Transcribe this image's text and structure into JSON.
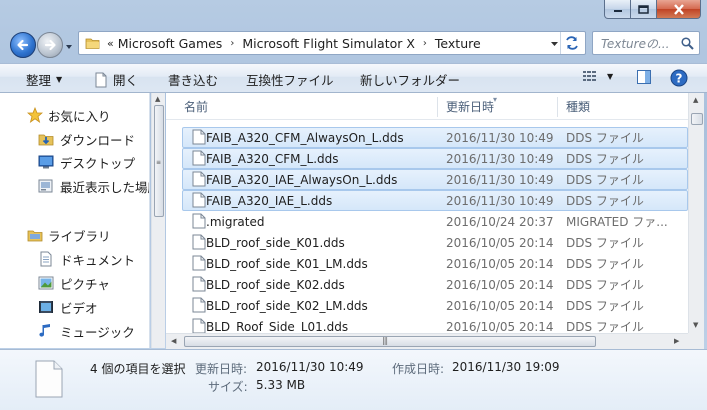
{
  "window": {
    "minimize_label": "Minimize",
    "maximize_label": "Maximize",
    "close_label": "Close"
  },
  "address": {
    "overflow": "«",
    "crumbs": [
      "Microsoft Games",
      "Microsoft Flight Simulator X",
      "Texture"
    ],
    "separator": "›"
  },
  "search": {
    "placeholder": "Textureの..."
  },
  "toolbar": {
    "organize": "整理",
    "open": "開く",
    "burn": "書き込む",
    "compat": "互換性ファイル",
    "new_folder": "新しいフォルダー"
  },
  "navpane": {
    "favorites": "お気に入り",
    "downloads": "ダウンロード",
    "desktop": "デスクトップ",
    "recent": "最近表示した場所",
    "libraries": "ライブラリ",
    "documents": "ドキュメント",
    "pictures": "ピクチャ",
    "videos": "ビデオ",
    "music": "ミュージック"
  },
  "columns": {
    "name": "名前",
    "date": "更新日時",
    "type": "種類"
  },
  "files": [
    {
      "name": "FAIB_A320_CFM_AlwaysOn_L.dds",
      "date": "2016/11/30 10:49",
      "type": "DDS ファイル",
      "selected": true
    },
    {
      "name": "FAIB_A320_CFM_L.dds",
      "date": "2016/11/30 10:49",
      "type": "DDS ファイル",
      "selected": true
    },
    {
      "name": "FAIB_A320_IAE_AlwaysOn_L.dds",
      "date": "2016/11/30 10:49",
      "type": "DDS ファイル",
      "selected": true
    },
    {
      "name": "FAIB_A320_IAE_L.dds",
      "date": "2016/11/30 10:49",
      "type": "DDS ファイル",
      "selected": true
    },
    {
      "name": ".migrated",
      "date": "2016/10/24 20:37",
      "type": "MIGRATED ファ...",
      "selected": false
    },
    {
      "name": "BLD_roof_side_K01.dds",
      "date": "2016/10/05 20:14",
      "type": "DDS ファイル",
      "selected": false
    },
    {
      "name": "BLD_roof_side_K01_LM.dds",
      "date": "2016/10/05 20:14",
      "type": "DDS ファイル",
      "selected": false
    },
    {
      "name": "BLD_roof_side_K02.dds",
      "date": "2016/10/05 20:14",
      "type": "DDS ファイル",
      "selected": false
    },
    {
      "name": "BLD_roof_side_K02_LM.dds",
      "date": "2016/10/05 20:14",
      "type": "DDS ファイル",
      "selected": false
    },
    {
      "name": "BLD_Roof_Side_L01.dds",
      "date": "2016/10/05 20:14",
      "type": "DDS ファイル",
      "selected": false
    }
  ],
  "details": {
    "selection_count": "4 個の項目を選択",
    "modified_label": "更新日時:",
    "modified_value": "2016/11/30 10:49",
    "created_label": "作成日時:",
    "created_value": "2016/11/30 19:09",
    "size_label": "サイズ:",
    "size_value": "5.33 MB"
  },
  "colors": {
    "selection_bg": "#d5e7fa",
    "selection_border": "#a8c8ec",
    "toolbar_bg": "#e3ebf5",
    "frame": "#b6cbe3"
  }
}
